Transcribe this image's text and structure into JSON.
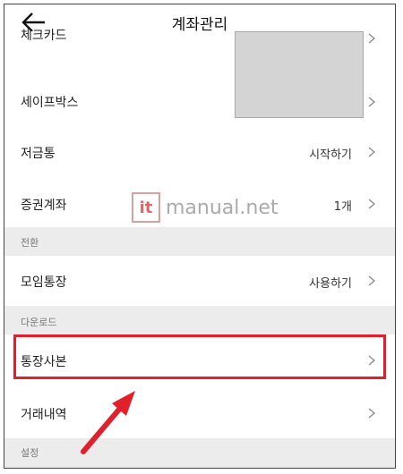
{
  "header": {
    "title": "계좌관리"
  },
  "rows": {
    "check_card": {
      "label": "체크카드"
    },
    "safebox": {
      "label": "세이프박스"
    },
    "piggy": {
      "label": "저금통",
      "value": "시작하기"
    },
    "securities": {
      "label": "증권계좌",
      "value": "1개"
    },
    "moim": {
      "label": "모임통장",
      "value": "사용하기"
    },
    "passbook_copy": {
      "label": "통장사본"
    },
    "transactions": {
      "label": "거래내역"
    }
  },
  "sections": {
    "switch": "전환",
    "download": "다운로드",
    "settings": "설정"
  },
  "watermark": {
    "mark": "it",
    "text": "manual.net"
  },
  "colors": {
    "highlight": "#e0212b",
    "section_bg": "#ececec"
  }
}
